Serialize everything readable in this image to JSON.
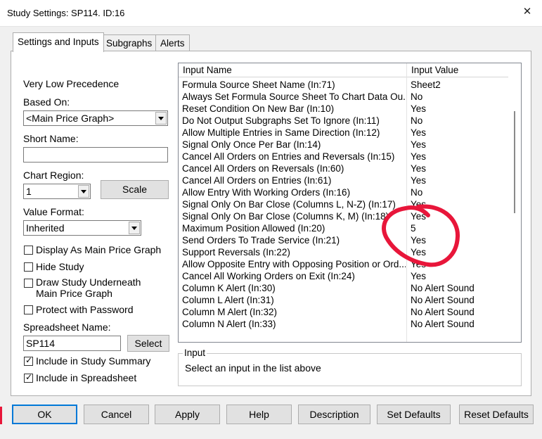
{
  "window": {
    "title": "Study Settings: SP114. ID:16",
    "close_icon": "close-icon"
  },
  "tabs": [
    {
      "label": "Settings and Inputs",
      "active": true
    },
    {
      "label": "Subgraphs",
      "active": false
    },
    {
      "label": "Alerts",
      "active": false
    }
  ],
  "left": {
    "precedence": "Very Low Precedence",
    "based_on_label": "Based On:",
    "based_on_value": "<Main Price Graph>",
    "short_name_label": "Short Name:",
    "short_name_value": "",
    "chart_region_label": "Chart Region:",
    "chart_region_value": "1",
    "scale_button": "Scale",
    "value_format_label": "Value Format:",
    "value_format_value": "Inherited",
    "options": [
      {
        "label": "Display As Main Price Graph",
        "checked": false
      },
      {
        "label": "Hide Study",
        "checked": false
      },
      {
        "label": "Draw Study Underneath",
        "label2": "Main Price Graph",
        "checked": false
      },
      {
        "label": "Protect with Password",
        "checked": false
      }
    ],
    "spreadsheet_name_label": "Spreadsheet Name:",
    "spreadsheet_name_value": "SP114",
    "select_button": "Select",
    "include_summary": {
      "label": "Include in Study Summary",
      "checked": true
    },
    "include_spreadsheet": {
      "label": "Include in Spreadsheet",
      "checked": true
    }
  },
  "inputs_table": {
    "columns": [
      "Input Name",
      "Input Value"
    ],
    "rows": [
      {
        "name": "Formula Source Sheet Name  (In:71)",
        "value": "Sheet2"
      },
      {
        "name": "Always Set Formula Source Sheet To Chart Data Ou...",
        "value": "No"
      },
      {
        "name": "Reset Condition On New Bar  (In:10)",
        "value": "Yes"
      },
      {
        "name": "Do Not Output Subgraphs Set To Ignore  (In:11)",
        "value": "No"
      },
      {
        "name": "Allow Multiple Entries in Same Direction  (In:12)",
        "value": "Yes"
      },
      {
        "name": "Signal Only Once Per Bar  (In:14)",
        "value": "Yes"
      },
      {
        "name": "Cancel All Orders on Entries and Reversals  (In:15)",
        "value": "Yes"
      },
      {
        "name": "Cancel All Orders on Reversals  (In:60)",
        "value": "Yes"
      },
      {
        "name": "Cancel All Orders on Entries  (In:61)",
        "value": "Yes"
      },
      {
        "name": "Allow Entry With Working Orders  (In:16)",
        "value": "No"
      },
      {
        "name": "Signal Only On Bar Close (Columns L, N-Z)  (In:17)",
        "value": "Yes"
      },
      {
        "name": "Signal Only On Bar Close (Columns K, M)  (In:18)",
        "value": "Yes"
      },
      {
        "name": "Maximum Position Allowed  (In:20)",
        "value": "5"
      },
      {
        "name": "Send Orders To Trade Service  (In:21)",
        "value": "Yes"
      },
      {
        "name": "Support Reversals  (In:22)",
        "value": "Yes"
      },
      {
        "name": "Allow Opposite Entry with Opposing Position or Ord...",
        "value": "Yes"
      },
      {
        "name": "Cancel All Working Orders on Exit  (In:24)",
        "value": "Yes"
      },
      {
        "name": "Column K Alert  (In:30)",
        "value": "No Alert Sound"
      },
      {
        "name": "Column L Alert  (In:31)",
        "value": "No Alert Sound"
      },
      {
        "name": "Column M Alert  (In:32)",
        "value": "No Alert Sound"
      },
      {
        "name": "Column N Alert  (In:33)",
        "value": "No Alert Sound"
      }
    ]
  },
  "input_group": {
    "legend": "Input",
    "text": "Select an input in the list above"
  },
  "buttons": [
    "OK",
    "Cancel",
    "Apply",
    "Help",
    "Description",
    "Set Defaults",
    "Reset Defaults"
  ],
  "colors": {
    "annotation": "#e8163a",
    "accent": "#0078d7"
  }
}
